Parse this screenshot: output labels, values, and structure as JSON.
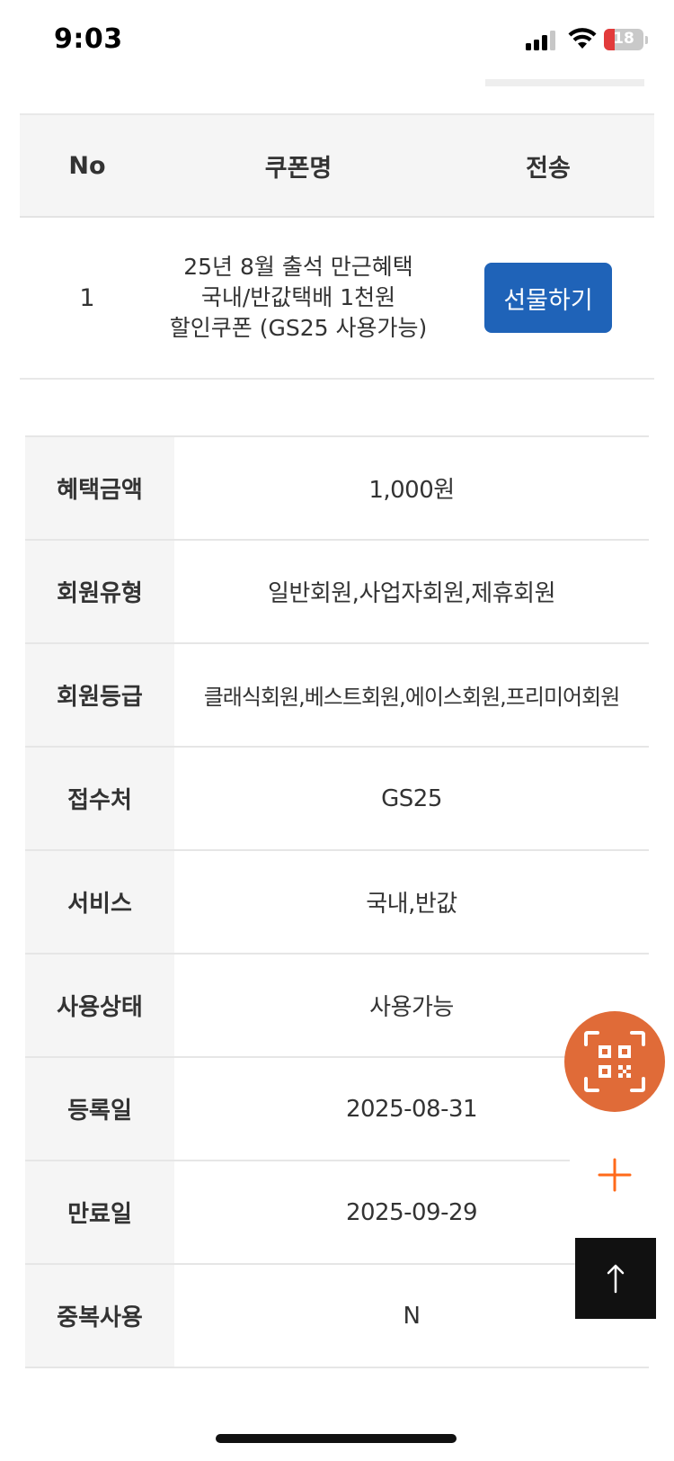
{
  "status_bar": {
    "time": "9:03",
    "battery": "18",
    "icons": [
      "signal-icon",
      "wifi-icon",
      "battery-icon"
    ]
  },
  "coupon_table": {
    "headers": [
      "No",
      "쿠폰명",
      "전송"
    ],
    "rows": [
      {
        "no": "1",
        "name_lines": [
          "25년 8월 출석 만근혜택",
          "국내/반값택배 1천원",
          "할인쿠폰 (GS25 사용가능)"
        ],
        "action": "선물하기"
      }
    ]
  },
  "details": [
    {
      "label": "혜택금액",
      "value": "1,000원"
    },
    {
      "label": "회원유형",
      "value": "일반회원,사업자회원,제휴회원"
    },
    {
      "label": "회원등급",
      "value": "클래식회원,베스트회원,에이스회원,프리미어회원"
    },
    {
      "label": "접수처",
      "value": "GS25"
    },
    {
      "label": "서비스",
      "value": "국내,반값"
    },
    {
      "label": "사용상태",
      "value": "사용가능"
    },
    {
      "label": "등록일",
      "value": "2025-08-31"
    },
    {
      "label": "만료일",
      "value": "2025-09-29"
    },
    {
      "label": "중복사용",
      "value": "N"
    }
  ],
  "floating": {
    "qr_icon": "qr-scan-icon",
    "plus_icon": "plus-icon",
    "top_icon": "arrow-up-icon"
  },
  "colors": {
    "gift_button": "#1f63b8",
    "qr_fab": "#e06b38",
    "plus": "#ff6a1a",
    "top_button": "#111111",
    "label_bg": "#f5f5f5"
  }
}
